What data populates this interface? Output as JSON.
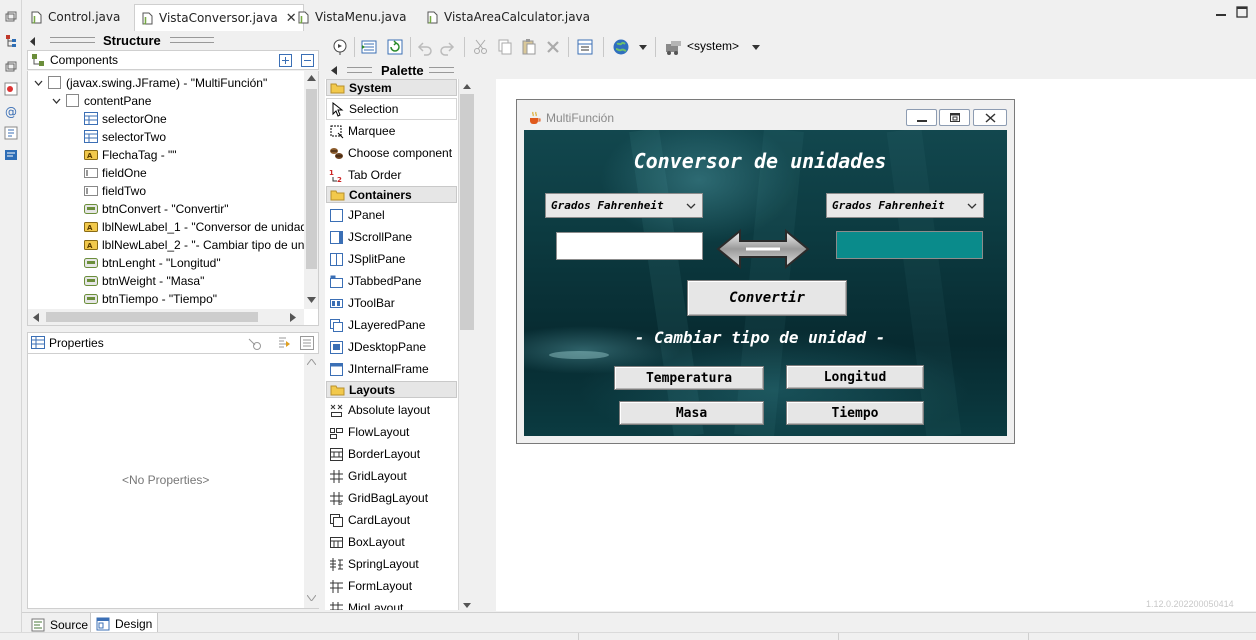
{
  "editor_tabs": [
    {
      "label": "Control.java",
      "active": false
    },
    {
      "label": "VistaConversor.java",
      "active": true
    },
    {
      "label": "VistaMenu.java",
      "active": false
    },
    {
      "label": "VistaAreaCalculator.java",
      "active": false
    }
  ],
  "structure": {
    "title": "Structure",
    "components_label": "Components",
    "tree": [
      {
        "label": "(javax.swing.JFrame) - \"MultiFunción\"",
        "icon": "frame-icon",
        "depth": 0,
        "expanded": true
      },
      {
        "label": "contentPane",
        "icon": "panel-icon",
        "depth": 1,
        "expanded": true
      },
      {
        "label": "selectorOne",
        "icon": "combobox-icon",
        "depth": 2
      },
      {
        "label": "selectorTwo",
        "icon": "combobox-icon",
        "depth": 2
      },
      {
        "label": "FlechaTag - \"\"",
        "icon": "label-icon",
        "depth": 2
      },
      {
        "label": "fieldOne",
        "icon": "textfield-icon",
        "depth": 2
      },
      {
        "label": "fieldTwo",
        "icon": "textfield-icon",
        "depth": 2
      },
      {
        "label": "btnConvert - \"Convertir\"",
        "icon": "button-icon",
        "depth": 2
      },
      {
        "label": "lblNewLabel_1 - \"Conversor de unidad",
        "icon": "label-icon",
        "depth": 2
      },
      {
        "label": "lblNewLabel_2 - \"- Cambiar tipo de un",
        "icon": "label-icon",
        "depth": 2
      },
      {
        "label": "btnLenght - \"Longitud\"",
        "icon": "button-icon",
        "depth": 2
      },
      {
        "label": "btnWeight - \"Masa\"",
        "icon": "button-icon",
        "depth": 2
      },
      {
        "label": "btnTiempo - \"Tiempo\"",
        "icon": "button-icon",
        "depth": 2
      }
    ]
  },
  "properties": {
    "title": "Properties",
    "empty_text": "<No Properties>"
  },
  "toolbar": {
    "system_label": "<system>"
  },
  "palette": {
    "title": "Palette",
    "categories": [
      {
        "name": "System",
        "items": [
          {
            "label": "Selection",
            "icon": "cursor-icon",
            "selected": true
          },
          {
            "label": "Marquee",
            "icon": "marquee-icon"
          },
          {
            "label": "Choose component",
            "icon": "beans-icon"
          },
          {
            "label": "Tab Order",
            "icon": "tab-order-icon"
          }
        ]
      },
      {
        "name": "Containers",
        "items": [
          {
            "label": "JPanel",
            "icon": "jpanel-icon"
          },
          {
            "label": "JScrollPane",
            "icon": "jscrollpane-icon"
          },
          {
            "label": "JSplitPane",
            "icon": "jsplitpane-icon"
          },
          {
            "label": "JTabbedPane",
            "icon": "jtabbedpane-icon"
          },
          {
            "label": "JToolBar",
            "icon": "jtoolbar-icon"
          },
          {
            "label": "JLayeredPane",
            "icon": "jlayeredpane-icon"
          },
          {
            "label": "JDesktopPane",
            "icon": "jdesktoppane-icon"
          },
          {
            "label": "JInternalFrame",
            "icon": "jinternalframe-icon"
          }
        ]
      },
      {
        "name": "Layouts",
        "items": [
          {
            "label": "Absolute layout",
            "icon": "absolute-layout-icon"
          },
          {
            "label": "FlowLayout",
            "icon": "flow-layout-icon"
          },
          {
            "label": "BorderLayout",
            "icon": "border-layout-icon"
          },
          {
            "label": "GridLayout",
            "icon": "grid-layout-icon"
          },
          {
            "label": "GridBagLayout",
            "icon": "gridbag-layout-icon"
          },
          {
            "label": "CardLayout",
            "icon": "card-layout-icon"
          },
          {
            "label": "BoxLayout",
            "icon": "box-layout-icon"
          },
          {
            "label": "SpringLayout",
            "icon": "spring-layout-icon"
          },
          {
            "label": "FormLayout",
            "icon": "form-layout-icon"
          },
          {
            "label": "MigLayout",
            "icon": "mig-layout-icon"
          }
        ]
      }
    ]
  },
  "jframe": {
    "title": "MultiFunción",
    "heading": "Conversor de unidades",
    "selector_one": "Grados Fahrenheit",
    "selector_two": "Grados Fahrenheit",
    "field_one_value": "",
    "field_two_value": "",
    "convert_button": "Convertir",
    "change_type_label": "- Cambiar tipo de unidad -",
    "btn_temperatura": "Temperatura",
    "btn_longitud": "Longitud",
    "btn_masa": "Masa",
    "btn_tiempo": "Tiempo"
  },
  "bottom_tabs": {
    "source": "Source",
    "design": "Design"
  },
  "version_text": "1.12.0.202200050414"
}
